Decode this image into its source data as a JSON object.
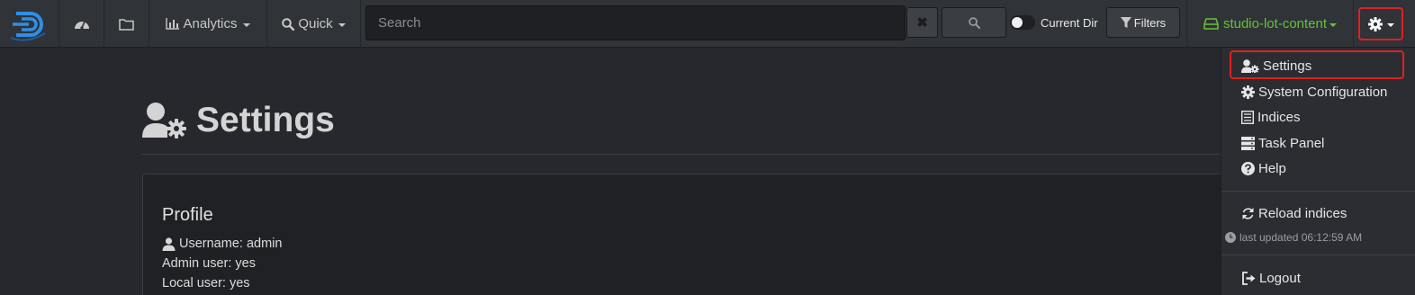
{
  "navbar": {
    "analytics_label": "Analytics",
    "quick_label": "Quick",
    "search_placeholder": "Search",
    "search_value": "",
    "current_dir_label": "Current Dir",
    "filters_label": "Filters",
    "index_name": "studio-lot-content"
  },
  "page": {
    "title": "Settings"
  },
  "profile": {
    "title": "Profile",
    "username_line": "Username: admin",
    "admin_line": "Admin user: yes",
    "local_line": "Local user: yes"
  },
  "menu": {
    "items": [
      {
        "label": "Settings",
        "icon": "user-gear-icon"
      },
      {
        "label": "System Configuration",
        "icon": "gear-icon"
      },
      {
        "label": "Indices",
        "icon": "list-icon"
      },
      {
        "label": "Task Panel",
        "icon": "server-icon"
      },
      {
        "label": "Help",
        "icon": "question-circle-icon"
      },
      {
        "label": "Reload indices",
        "icon": "refresh-icon"
      },
      {
        "label": "Logout",
        "icon": "logout-icon"
      }
    ],
    "last_updated": "last updated 06:12:59 AM"
  },
  "colors": {
    "accent_green": "#67c23a",
    "highlight_red": "#e02020",
    "logo_blue": "#2f8ee6"
  }
}
